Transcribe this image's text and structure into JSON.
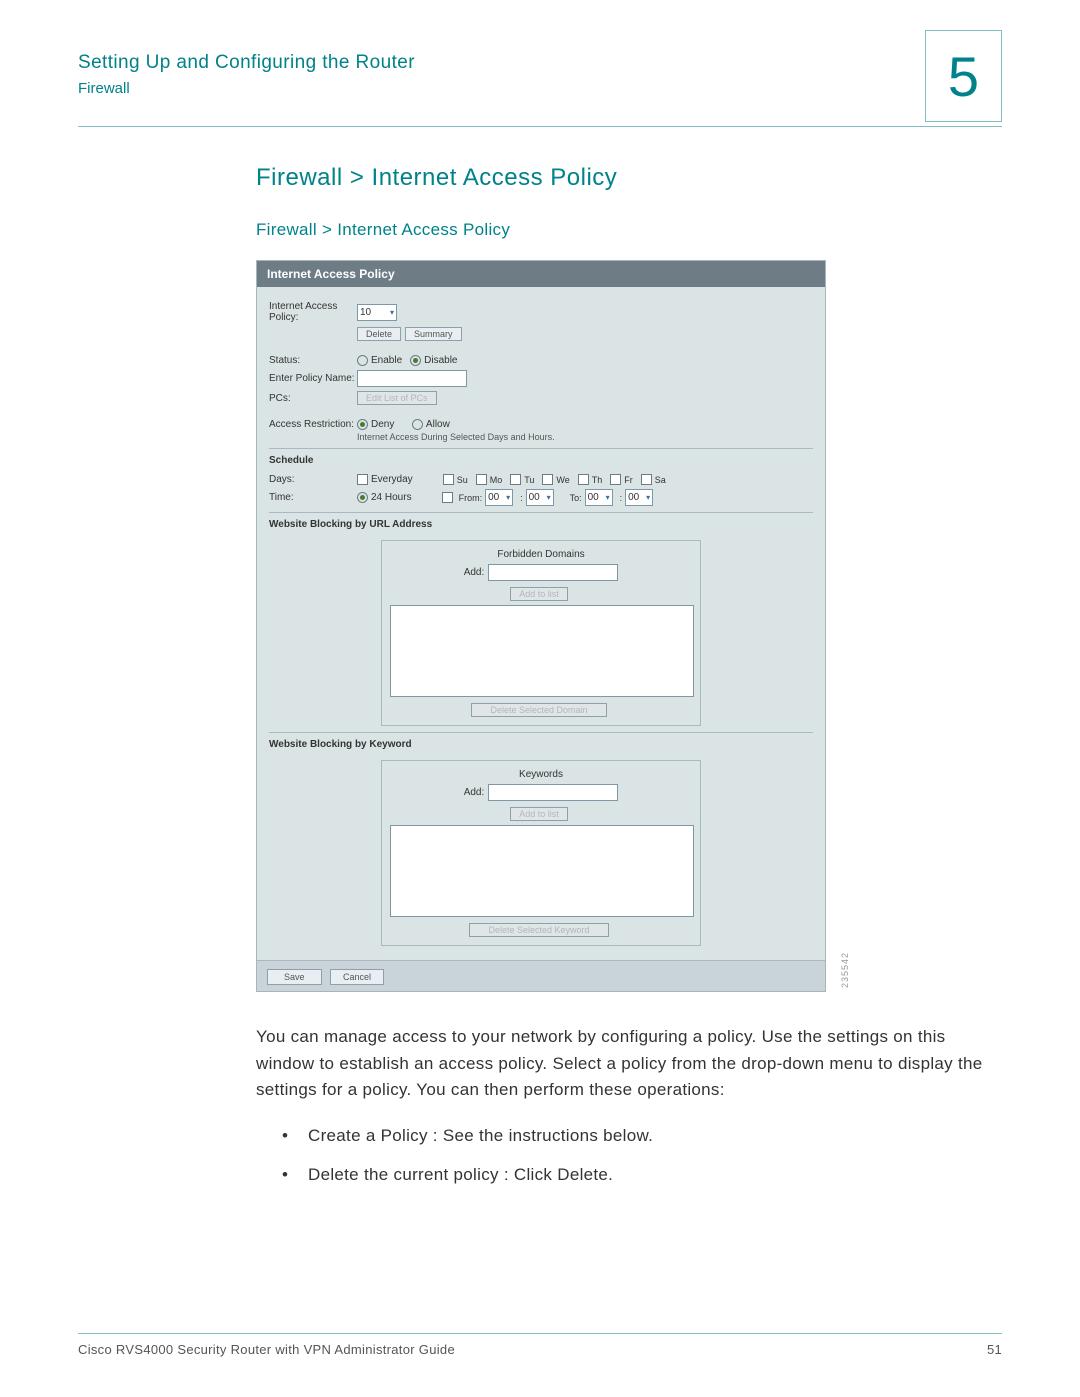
{
  "header": {
    "title": "Setting Up and Configuring the Router",
    "subtitle": "Firewall",
    "chapter": "5"
  },
  "main": {
    "h1": "Firewall > Internet Access Policy",
    "h2": "Firewall > Internet Access Policy"
  },
  "screenshot": {
    "panel_title": "Internet Access Policy",
    "policy_label": "Internet Access Policy:",
    "policy_value": "10",
    "delete_btn": "Delete",
    "summary_btn": "Summary",
    "status_label": "Status:",
    "status_enable": "Enable",
    "status_disable": "Disable",
    "policy_name_label": "Enter Policy Name:",
    "pcs_label": "PCs:",
    "edit_pcs_btn": "Edit List of PCs",
    "access_label": "Access Restriction:",
    "deny": "Deny",
    "allow": "Allow",
    "access_note": "Internet Access During Selected Days and Hours.",
    "schedule_hdr": "Schedule",
    "days_label": "Days:",
    "everyday": "Everyday",
    "days": [
      "Su",
      "Mo",
      "Tu",
      "We",
      "Th",
      "Fr",
      "Sa"
    ],
    "time_label": "Time:",
    "all_hours": "24 Hours",
    "from": "From:",
    "to": "To:",
    "hh": "00",
    "mm": "00",
    "url_hdr": "Website Blocking by URL Address",
    "forbidden": "Forbidden Domains",
    "add": "Add:",
    "add_to_list": "Add to list",
    "del_domain": "Delete Selected Domain",
    "kw_hdr": "Website Blocking by Keyword",
    "keywords": "Keywords",
    "del_keyword": "Delete Selected Keyword",
    "save": "Save",
    "cancel": "Cancel",
    "watermark": "235542"
  },
  "body": {
    "para": "You can manage access to your network by configuring a policy. Use the settings on this window to establish an access policy. Select a policy from the drop-down menu to display the settings for a policy. You can then perform these operations:",
    "bullets": [
      "Create a Policy : See the instructions below.",
      "Delete the current policy : Click Delete."
    ]
  },
  "footer": {
    "left": "Cisco RVS4000 Security Router with VPN Administrator Guide",
    "right": "51"
  }
}
